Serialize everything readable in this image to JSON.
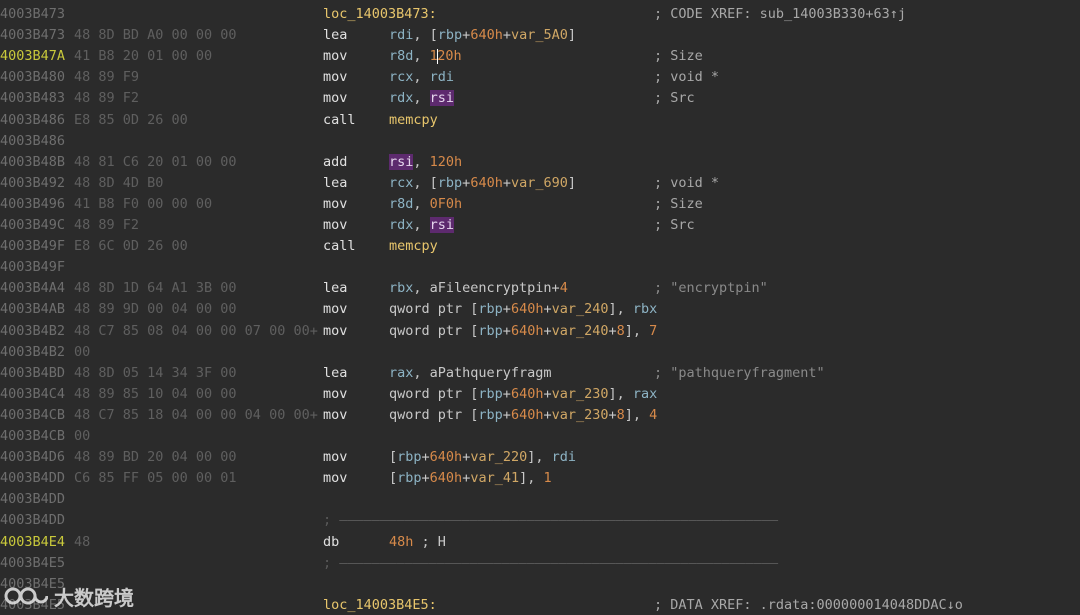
{
  "lines": [
    {
      "addr": "4003B473",
      "label": "loc_14003B473:",
      "comment": "; CODE XREF: sub_14003B330+63↑j"
    },
    {
      "addr": "4003B473",
      "bytes": "48 8D BD A0 00 00 00",
      "mnemonic": "lea",
      "operands": [
        {
          "t": "reg",
          "v": "rdi"
        },
        {
          "t": "op",
          "v": ", ["
        },
        {
          "t": "reg",
          "v": "rbp"
        },
        {
          "t": "op",
          "v": "+"
        },
        {
          "t": "num",
          "v": "640h"
        },
        {
          "t": "op",
          "v": "+"
        },
        {
          "t": "var",
          "v": "var_5A0"
        },
        {
          "t": "op",
          "v": "]"
        }
      ]
    },
    {
      "addr": "4003B47A",
      "current": true,
      "bytes": "41 B8 20 01 00 00",
      "mnemonic": "mov",
      "operands": [
        {
          "t": "reg",
          "v": "r8d"
        },
        {
          "t": "op",
          "v": ", "
        },
        {
          "t": "num",
          "v": "1"
        },
        {
          "t": "caret"
        },
        {
          "t": "num",
          "v": "20h"
        }
      ],
      "comment": "; Size"
    },
    {
      "addr": "4003B480",
      "bytes": "48 89 F9",
      "mnemonic": "mov",
      "operands": [
        {
          "t": "reg",
          "v": "rcx"
        },
        {
          "t": "op",
          "v": ", "
        },
        {
          "t": "reg",
          "v": "rdi"
        }
      ],
      "comment": "; void *"
    },
    {
      "addr": "4003B483",
      "bytes": "48 89 F2",
      "mnemonic": "mov",
      "operands": [
        {
          "t": "reg",
          "v": "rdx"
        },
        {
          "t": "op",
          "v": ", "
        },
        {
          "t": "hl",
          "v": "rsi"
        }
      ],
      "comment": "; Src"
    },
    {
      "addr": "4003B486",
      "bytes": "E8 85 0D 26 00",
      "mnemonic": "call",
      "operands": [
        {
          "t": "fn",
          "v": "memcpy"
        }
      ]
    },
    {
      "addr": "4003B486"
    },
    {
      "addr": "4003B48B",
      "bytes": "48 81 C6 20 01 00 00",
      "mnemonic": "add",
      "operands": [
        {
          "t": "hl",
          "v": "rsi"
        },
        {
          "t": "op",
          "v": ", "
        },
        {
          "t": "num",
          "v": "120h"
        }
      ]
    },
    {
      "addr": "4003B492",
      "bytes": "48 8D 4D B0",
      "mnemonic": "lea",
      "operands": [
        {
          "t": "reg",
          "v": "rcx"
        },
        {
          "t": "op",
          "v": ", ["
        },
        {
          "t": "reg",
          "v": "rbp"
        },
        {
          "t": "op",
          "v": "+"
        },
        {
          "t": "num",
          "v": "640h"
        },
        {
          "t": "op",
          "v": "+"
        },
        {
          "t": "var",
          "v": "var_690"
        },
        {
          "t": "op",
          "v": "]"
        }
      ],
      "comment": "; void *"
    },
    {
      "addr": "4003B496",
      "bytes": "41 B8 F0 00 00 00",
      "mnemonic": "mov",
      "operands": [
        {
          "t": "reg",
          "v": "r8d"
        },
        {
          "t": "op",
          "v": ", "
        },
        {
          "t": "num",
          "v": "0F0h"
        }
      ],
      "comment": "; Size"
    },
    {
      "addr": "4003B49C",
      "bytes": "48 89 F2",
      "mnemonic": "mov",
      "operands": [
        {
          "t": "reg",
          "v": "rdx"
        },
        {
          "t": "op",
          "v": ", "
        },
        {
          "t": "hl",
          "v": "rsi"
        }
      ],
      "comment": "; Src"
    },
    {
      "addr": "4003B49F",
      "bytes": "E8 6C 0D 26 00",
      "mnemonic": "call",
      "operands": [
        {
          "t": "fn",
          "v": "memcpy"
        }
      ]
    },
    {
      "addr": "4003B49F"
    },
    {
      "addr": "4003B4A4",
      "bytes": "48 8D 1D 64 A1 3B 00",
      "mnemonic": "lea",
      "operands": [
        {
          "t": "reg",
          "v": "rbx"
        },
        {
          "t": "op",
          "v": ", aFileencryptpin+"
        },
        {
          "t": "num",
          "v": "4"
        }
      ],
      "comment": "; \"encryptpin\"",
      "comment_str": true
    },
    {
      "addr": "4003B4AB",
      "bytes": "48 89 9D 00 04 00 00",
      "mnemonic": "mov",
      "operands": [
        {
          "t": "op",
          "v": "qword ptr ["
        },
        {
          "t": "reg",
          "v": "rbp"
        },
        {
          "t": "op",
          "v": "+"
        },
        {
          "t": "num",
          "v": "640h"
        },
        {
          "t": "op",
          "v": "+"
        },
        {
          "t": "var",
          "v": "var_240"
        },
        {
          "t": "op",
          "v": "], "
        },
        {
          "t": "reg",
          "v": "rbx"
        }
      ]
    },
    {
      "addr": "4003B4B2",
      "bytes": "48 C7 85 08 04 00 00 07 00 00+",
      "mnemonic": "mov",
      "operands": [
        {
          "t": "op",
          "v": "qword ptr ["
        },
        {
          "t": "reg",
          "v": "rbp"
        },
        {
          "t": "op",
          "v": "+"
        },
        {
          "t": "num",
          "v": "640h"
        },
        {
          "t": "op",
          "v": "+"
        },
        {
          "t": "var",
          "v": "var_240"
        },
        {
          "t": "op",
          "v": "+"
        },
        {
          "t": "num",
          "v": "8"
        },
        {
          "t": "op",
          "v": "], "
        },
        {
          "t": "num",
          "v": "7"
        }
      ]
    },
    {
      "addr": "4003B4B2",
      "bytes": "00"
    },
    {
      "addr": "4003B4BD",
      "bytes": "48 8D 05 14 34 3F 00",
      "mnemonic": "lea",
      "operands": [
        {
          "t": "reg",
          "v": "rax"
        },
        {
          "t": "op",
          "v": ", aPathqueryfragm"
        }
      ],
      "comment": "; \"pathqueryfragment\"",
      "comment_str": true
    },
    {
      "addr": "4003B4C4",
      "bytes": "48 89 85 10 04 00 00",
      "mnemonic": "mov",
      "operands": [
        {
          "t": "op",
          "v": "qword ptr ["
        },
        {
          "t": "reg",
          "v": "rbp"
        },
        {
          "t": "op",
          "v": "+"
        },
        {
          "t": "num",
          "v": "640h"
        },
        {
          "t": "op",
          "v": "+"
        },
        {
          "t": "var",
          "v": "var_230"
        },
        {
          "t": "op",
          "v": "], "
        },
        {
          "t": "reg",
          "v": "rax"
        }
      ]
    },
    {
      "addr": "4003B4CB",
      "bytes": "48 C7 85 18 04 00 00 04 00 00+",
      "mnemonic": "mov",
      "operands": [
        {
          "t": "op",
          "v": "qword ptr ["
        },
        {
          "t": "reg",
          "v": "rbp"
        },
        {
          "t": "op",
          "v": "+"
        },
        {
          "t": "num",
          "v": "640h"
        },
        {
          "t": "op",
          "v": "+"
        },
        {
          "t": "var",
          "v": "var_230"
        },
        {
          "t": "op",
          "v": "+"
        },
        {
          "t": "num",
          "v": "8"
        },
        {
          "t": "op",
          "v": "], "
        },
        {
          "t": "num",
          "v": "4"
        }
      ]
    },
    {
      "addr": "4003B4CB",
      "bytes": "00"
    },
    {
      "addr": "4003B4D6",
      "bytes": "48 89 BD 20 04 00 00",
      "mnemonic": "mov",
      "operands": [
        {
          "t": "op",
          "v": "["
        },
        {
          "t": "reg",
          "v": "rbp"
        },
        {
          "t": "op",
          "v": "+"
        },
        {
          "t": "num",
          "v": "640h"
        },
        {
          "t": "op",
          "v": "+"
        },
        {
          "t": "var",
          "v": "var_220"
        },
        {
          "t": "op",
          "v": "], "
        },
        {
          "t": "reg",
          "v": "rdi"
        }
      ]
    },
    {
      "addr": "4003B4DD",
      "bytes": "C6 85 FF 05 00 00 01",
      "mnemonic": "mov",
      "operands": [
        {
          "t": "op",
          "v": "["
        },
        {
          "t": "reg",
          "v": "rbp"
        },
        {
          "t": "op",
          "v": "+"
        },
        {
          "t": "num",
          "v": "640h"
        },
        {
          "t": "op",
          "v": "+"
        },
        {
          "t": "var",
          "v": "var_41"
        },
        {
          "t": "op",
          "v": "], "
        },
        {
          "t": "num",
          "v": "1"
        }
      ]
    },
    {
      "addr": "4003B4DD"
    },
    {
      "addr": "4003B4DD",
      "separator": "; ——————————————————————————————————————————————————————"
    },
    {
      "addr": "4003B4E4",
      "current": true,
      "bytes": "48",
      "mnemonic": "db",
      "operands": [
        {
          "t": "num",
          "v": "48h"
        },
        {
          "t": "op",
          "v": " ; H"
        }
      ]
    },
    {
      "addr": "4003B4E5",
      "separator": "; ——————————————————————————————————————————————————————"
    },
    {
      "addr": "4003B4E5"
    },
    {
      "addr": "4003B4E5",
      "label": "loc_14003B4E5:",
      "comment": "; DATA XREF: .rdata:000000014048DDAC↓o"
    }
  ],
  "watermark": {
    "text": "大数跨境",
    "icon": "logo-icon"
  }
}
